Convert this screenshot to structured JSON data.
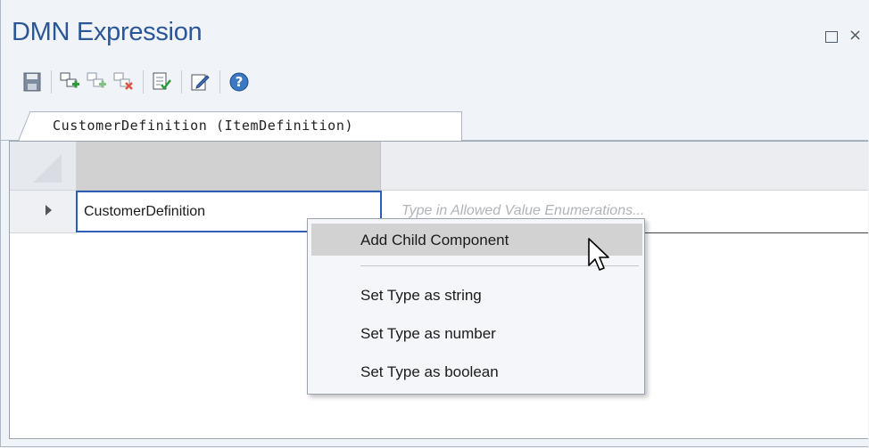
{
  "window": {
    "title": "DMN Expression",
    "restore_icon": "restore-icon",
    "close_label": "×"
  },
  "toolbar": {
    "buttons": [
      {
        "icon": "save-icon"
      },
      {
        "icon": "add-component-icon"
      },
      {
        "icon": "add-child-component-icon"
      },
      {
        "icon": "delete-component-icon"
      },
      {
        "icon": "validate-icon"
      },
      {
        "icon": "edit-icon"
      },
      {
        "icon": "help-icon"
      }
    ]
  },
  "tab": {
    "label": "CustomerDefinition (ItemDefinition)"
  },
  "grid": {
    "row": {
      "name": "CustomerDefinition",
      "enum_placeholder": "Type in Allowed Value Enumerations..."
    }
  },
  "context_menu": {
    "items": [
      {
        "label": "Add Child Component",
        "highlighted": true
      },
      {
        "label": "Set Type as string"
      },
      {
        "label": "Set Type as number"
      },
      {
        "label": "Set Type as boolean"
      }
    ]
  },
  "colors": {
    "title": "#2b5797",
    "selection_border": "#2c5eb3",
    "menu_highlight": "#d2d2d2"
  }
}
